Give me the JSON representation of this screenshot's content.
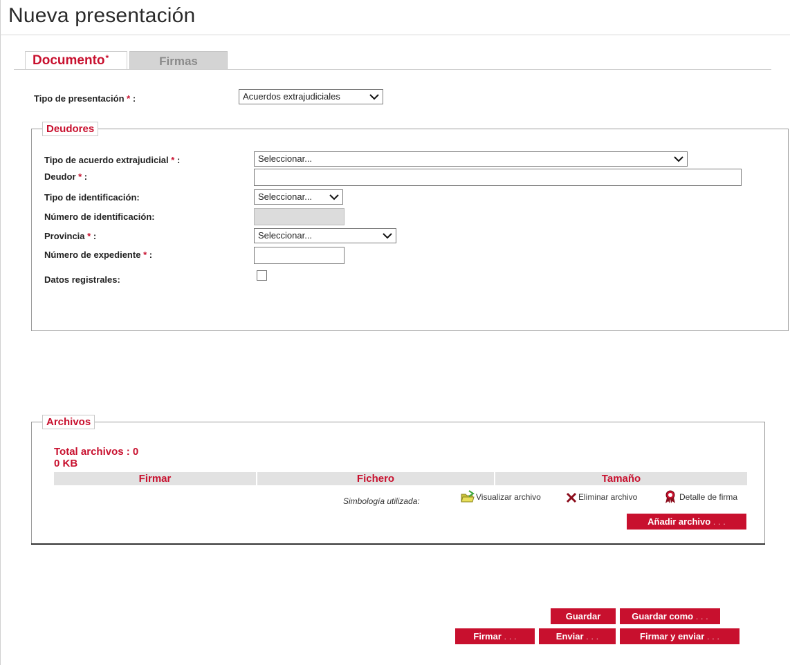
{
  "page": {
    "title": "Nueva presentación"
  },
  "tabs": [
    {
      "label": "Documento",
      "marker": "*",
      "active": true
    },
    {
      "label": "Firmas",
      "active": false
    }
  ],
  "tipo_presentacion": {
    "label": "Tipo de presentación",
    "required": "*",
    "colon": " :",
    "value": "Acuerdos extrajudiciales"
  },
  "deudores": {
    "legend": "Deudores",
    "fields": {
      "tipo_acuerdo": {
        "label": "Tipo de acuerdo extrajudicial",
        "required": "*",
        "colon": " :",
        "value": "Seleccionar..."
      },
      "deudor": {
        "label": "Deudor",
        "required": "*",
        "colon": " :",
        "value": ""
      },
      "tipo_identificacion": {
        "label": "Tipo de identificación:",
        "value": "Seleccionar..."
      },
      "numero_identificacion": {
        "label": "Número de identificación:",
        "value": ""
      },
      "provincia": {
        "label": "Provincia",
        "required": "*",
        "colon": " :",
        "value": "Seleccionar..."
      },
      "numero_expediente": {
        "label": "Número de expediente",
        "required": "*",
        "colon": " :",
        "value": ""
      },
      "datos_registrales": {
        "label": "Datos registrales:",
        "checked": false
      }
    }
  },
  "archivos": {
    "legend": "Archivos",
    "total": "Total archivos : 0",
    "size": "0 KB",
    "columns": [
      "Firmar",
      "Fichero",
      "Tamaño"
    ],
    "symbology": {
      "title": "Simbología utilizada:",
      "items": [
        {
          "icon": "folder-view-icon",
          "label": "Visualizar archivo"
        },
        {
          "icon": "delete-x-icon",
          "label": "Eliminar archivo"
        },
        {
          "icon": "signature-ribbon-icon",
          "label": "Detalle de firma"
        }
      ]
    },
    "add_button": {
      "label": "Añadir archivo",
      "dots": " . . ."
    }
  },
  "actions": {
    "guardar": {
      "label": "Guardar"
    },
    "guardar_como": {
      "label": "Guardar como",
      "dots": " . . ."
    },
    "firmar": {
      "label": "Firmar",
      "dots": " . . ."
    },
    "enviar": {
      "label": "Enviar",
      "dots": " . . ."
    },
    "firmar_enviar": {
      "label": "Firmar y enviar",
      "dots": " . . ."
    }
  },
  "colors": {
    "accent": "#c8102e",
    "tab_inactive": "#d4d4d4",
    "table_header": "#e2e2e2"
  }
}
